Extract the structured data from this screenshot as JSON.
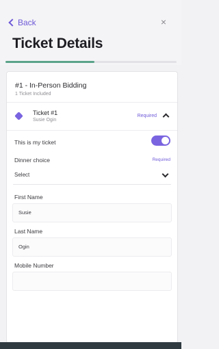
{
  "header": {
    "back_label": "Back",
    "close_symbol": "×",
    "title": "Ticket Details",
    "progress_fraction": 0.52
  },
  "card": {
    "title": "#1 - In-Person Bidding",
    "subtitle": "1 Ticket Included"
  },
  "ticket": {
    "icon": "tag-icon",
    "name": "Ticket #1",
    "holder": "Susie Ogin",
    "required_label": "Required"
  },
  "form": {
    "my_ticket_label": "This is my ticket",
    "my_ticket_on": true,
    "dinner_label": "Dinner choice",
    "dinner_required": "Required",
    "dinner_value": "Select",
    "first_name_label": "First Name",
    "first_name_value": "Susie",
    "last_name_label": "Last Name",
    "last_name_value": "Ogin",
    "mobile_label": "Mobile Number",
    "mobile_value": ""
  },
  "colors": {
    "accent": "#7a64e0",
    "progress": "#5aa38a",
    "footer": "#2f3a40"
  }
}
